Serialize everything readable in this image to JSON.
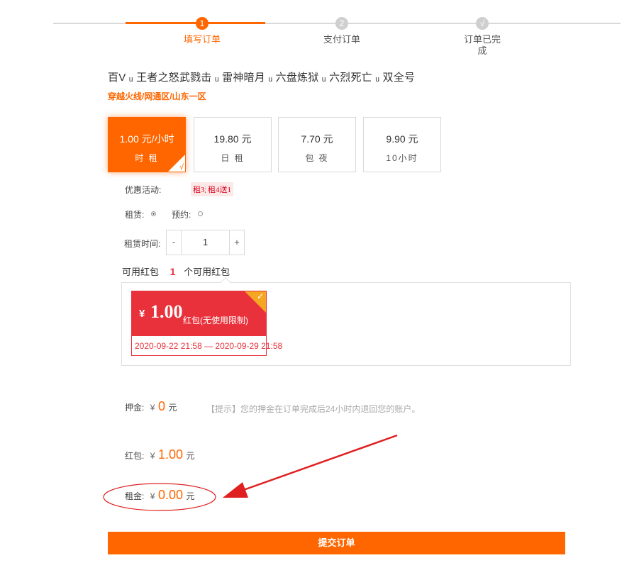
{
  "steps": [
    {
      "num": "1",
      "label": "填写订单"
    },
    {
      "num": "2",
      "label": "支付订单"
    },
    {
      "num": "√",
      "label_line1": "订单已完",
      "label_line2": "成"
    }
  ],
  "product": {
    "title": "百V ᵤ 王者之怒武戮击 ᵤ 雷神暗月 ᵤ 六盘炼狱 ᵤ 六烈死亡 ᵤ 双全号",
    "subtitle": "穿越火线/网通区/山东一区"
  },
  "price_options": [
    {
      "amount": "1.00 元/小时",
      "name": "时 租",
      "selected": true
    },
    {
      "amount": "19.80 元",
      "name": "日 租",
      "selected": false
    },
    {
      "amount": "7.70 元",
      "name": "包 夜",
      "selected": false
    },
    {
      "amount": "9.90 元",
      "name": "10小时",
      "selected": false
    }
  ],
  "promo": {
    "label": "优惠活动:",
    "tags": [
      "租3送1",
      "租4送1"
    ]
  },
  "rental_mode": {
    "rent_label": "租赁:",
    "reserve_label": "预约:",
    "selected": "rent"
  },
  "rental_time": {
    "label": "租赁时间:",
    "minus": "-",
    "value": "1",
    "plus": "+"
  },
  "red_packet": {
    "label": "可用红包",
    "count": "1",
    "count_suffix": "个可用红包",
    "coupon": {
      "yen": "¥",
      "amount": "1.00",
      "desc": "红包(无使用限制)",
      "validity": "2020-09-22 21:58 — 2020-09-29 21:58"
    }
  },
  "summary": {
    "deposit_label": "押金:",
    "deposit_yen": "¥",
    "deposit_value": "0",
    "deposit_unit": "元",
    "deposit_hint": "【提示】您的押金在订单完成后24小时内退回您的账户。",
    "packet_label": "红包:",
    "packet_yen": "¥",
    "packet_value": "1.00",
    "packet_unit": "元",
    "rent_label": "租金:",
    "rent_yen": "¥",
    "rent_value": "0.00",
    "rent_unit": "元"
  },
  "submit_label": "提交订单",
  "colors": {
    "accent": "#ff6600",
    "coupon_red": "#e8313b",
    "annotation_red": "#e02020"
  }
}
